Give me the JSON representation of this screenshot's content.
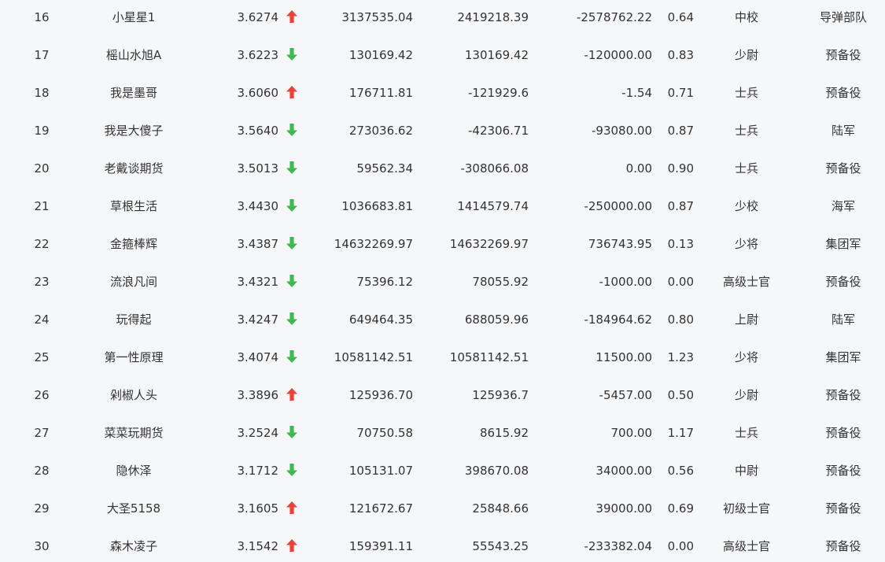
{
  "colors": {
    "up": "#e8403a",
    "down": "#3fb950",
    "text": "#333333",
    "background": "#f6f7f9"
  },
  "rows": [
    {
      "rank": "16",
      "name": "小星星1",
      "score": "3.6274",
      "trend": "up",
      "v1": "3137535.04",
      "v2": "2419218.39",
      "v3": "-2578762.22",
      "ratio": "0.64",
      "rank_title": "中校",
      "unit": "导弹部队"
    },
    {
      "rank": "17",
      "name": "榣山水旭A",
      "score": "3.6223",
      "trend": "down",
      "v1": "130169.42",
      "v2": "130169.42",
      "v3": "-120000.00",
      "ratio": "0.83",
      "rank_title": "少尉",
      "unit": "预备役"
    },
    {
      "rank": "18",
      "name": "我是墨哥",
      "score": "3.6060",
      "trend": "up",
      "v1": "176711.81",
      "v2": "-121929.6",
      "v3": "-1.54",
      "ratio": "0.71",
      "rank_title": "士兵",
      "unit": "预备役"
    },
    {
      "rank": "19",
      "name": "我是大傻子",
      "score": "3.5640",
      "trend": "down",
      "v1": "273036.62",
      "v2": "-42306.71",
      "v3": "-93080.00",
      "ratio": "0.87",
      "rank_title": "士兵",
      "unit": "陆军"
    },
    {
      "rank": "20",
      "name": "老戴谈期货",
      "score": "3.5013",
      "trend": "down",
      "v1": "59562.34",
      "v2": "-308066.08",
      "v3": "0.00",
      "ratio": "0.90",
      "rank_title": "士兵",
      "unit": "预备役"
    },
    {
      "rank": "21",
      "name": "草根生活",
      "score": "3.4430",
      "trend": "down",
      "v1": "1036683.81",
      "v2": "1414579.74",
      "v3": "-250000.00",
      "ratio": "0.87",
      "rank_title": "少校",
      "unit": "海军"
    },
    {
      "rank": "22",
      "name": "金箍棒辉",
      "score": "3.4387",
      "trend": "down",
      "v1": "14632269.97",
      "v2": "14632269.97",
      "v3": "736743.95",
      "ratio": "0.13",
      "rank_title": "少将",
      "unit": "集团军"
    },
    {
      "rank": "23",
      "name": "流浪凡间",
      "score": "3.4321",
      "trend": "down",
      "v1": "75396.12",
      "v2": "78055.92",
      "v3": "-1000.00",
      "ratio": "0.00",
      "rank_title": "高级士官",
      "unit": "预备役"
    },
    {
      "rank": "24",
      "name": "玩得起",
      "score": "3.4247",
      "trend": "down",
      "v1": "649464.35",
      "v2": "688059.96",
      "v3": "-184964.62",
      "ratio": "0.80",
      "rank_title": "上尉",
      "unit": "陆军"
    },
    {
      "rank": "25",
      "name": "第一性原理",
      "score": "3.4074",
      "trend": "down",
      "v1": "10581142.51",
      "v2": "10581142.51",
      "v3": "11500.00",
      "ratio": "1.23",
      "rank_title": "少将",
      "unit": "集团军"
    },
    {
      "rank": "26",
      "name": "剁椒人头",
      "score": "3.3896",
      "trend": "up",
      "v1": "125936.70",
      "v2": "125936.7",
      "v3": "-5457.00",
      "ratio": "0.50",
      "rank_title": "少尉",
      "unit": "预备役"
    },
    {
      "rank": "27",
      "name": "菜菜玩期货",
      "score": "3.2524",
      "trend": "down",
      "v1": "70750.58",
      "v2": "8615.92",
      "v3": "700.00",
      "ratio": "1.17",
      "rank_title": "士兵",
      "unit": "预备役"
    },
    {
      "rank": "28",
      "name": "隐休泽",
      "score": "3.1712",
      "trend": "down",
      "v1": "105131.07",
      "v2": "398670.08",
      "v3": "34000.00",
      "ratio": "0.56",
      "rank_title": "中尉",
      "unit": "预备役"
    },
    {
      "rank": "29",
      "name": "大圣5158",
      "score": "3.1605",
      "trend": "up",
      "v1": "121672.67",
      "v2": "25848.66",
      "v3": "39000.00",
      "ratio": "0.69",
      "rank_title": "初级士官",
      "unit": "预备役"
    },
    {
      "rank": "30",
      "name": "森木凌子",
      "score": "3.1542",
      "trend": "up",
      "v1": "159391.11",
      "v2": "55543.25",
      "v3": "-233382.04",
      "ratio": "0.00",
      "rank_title": "高级士官",
      "unit": "预备役"
    }
  ]
}
